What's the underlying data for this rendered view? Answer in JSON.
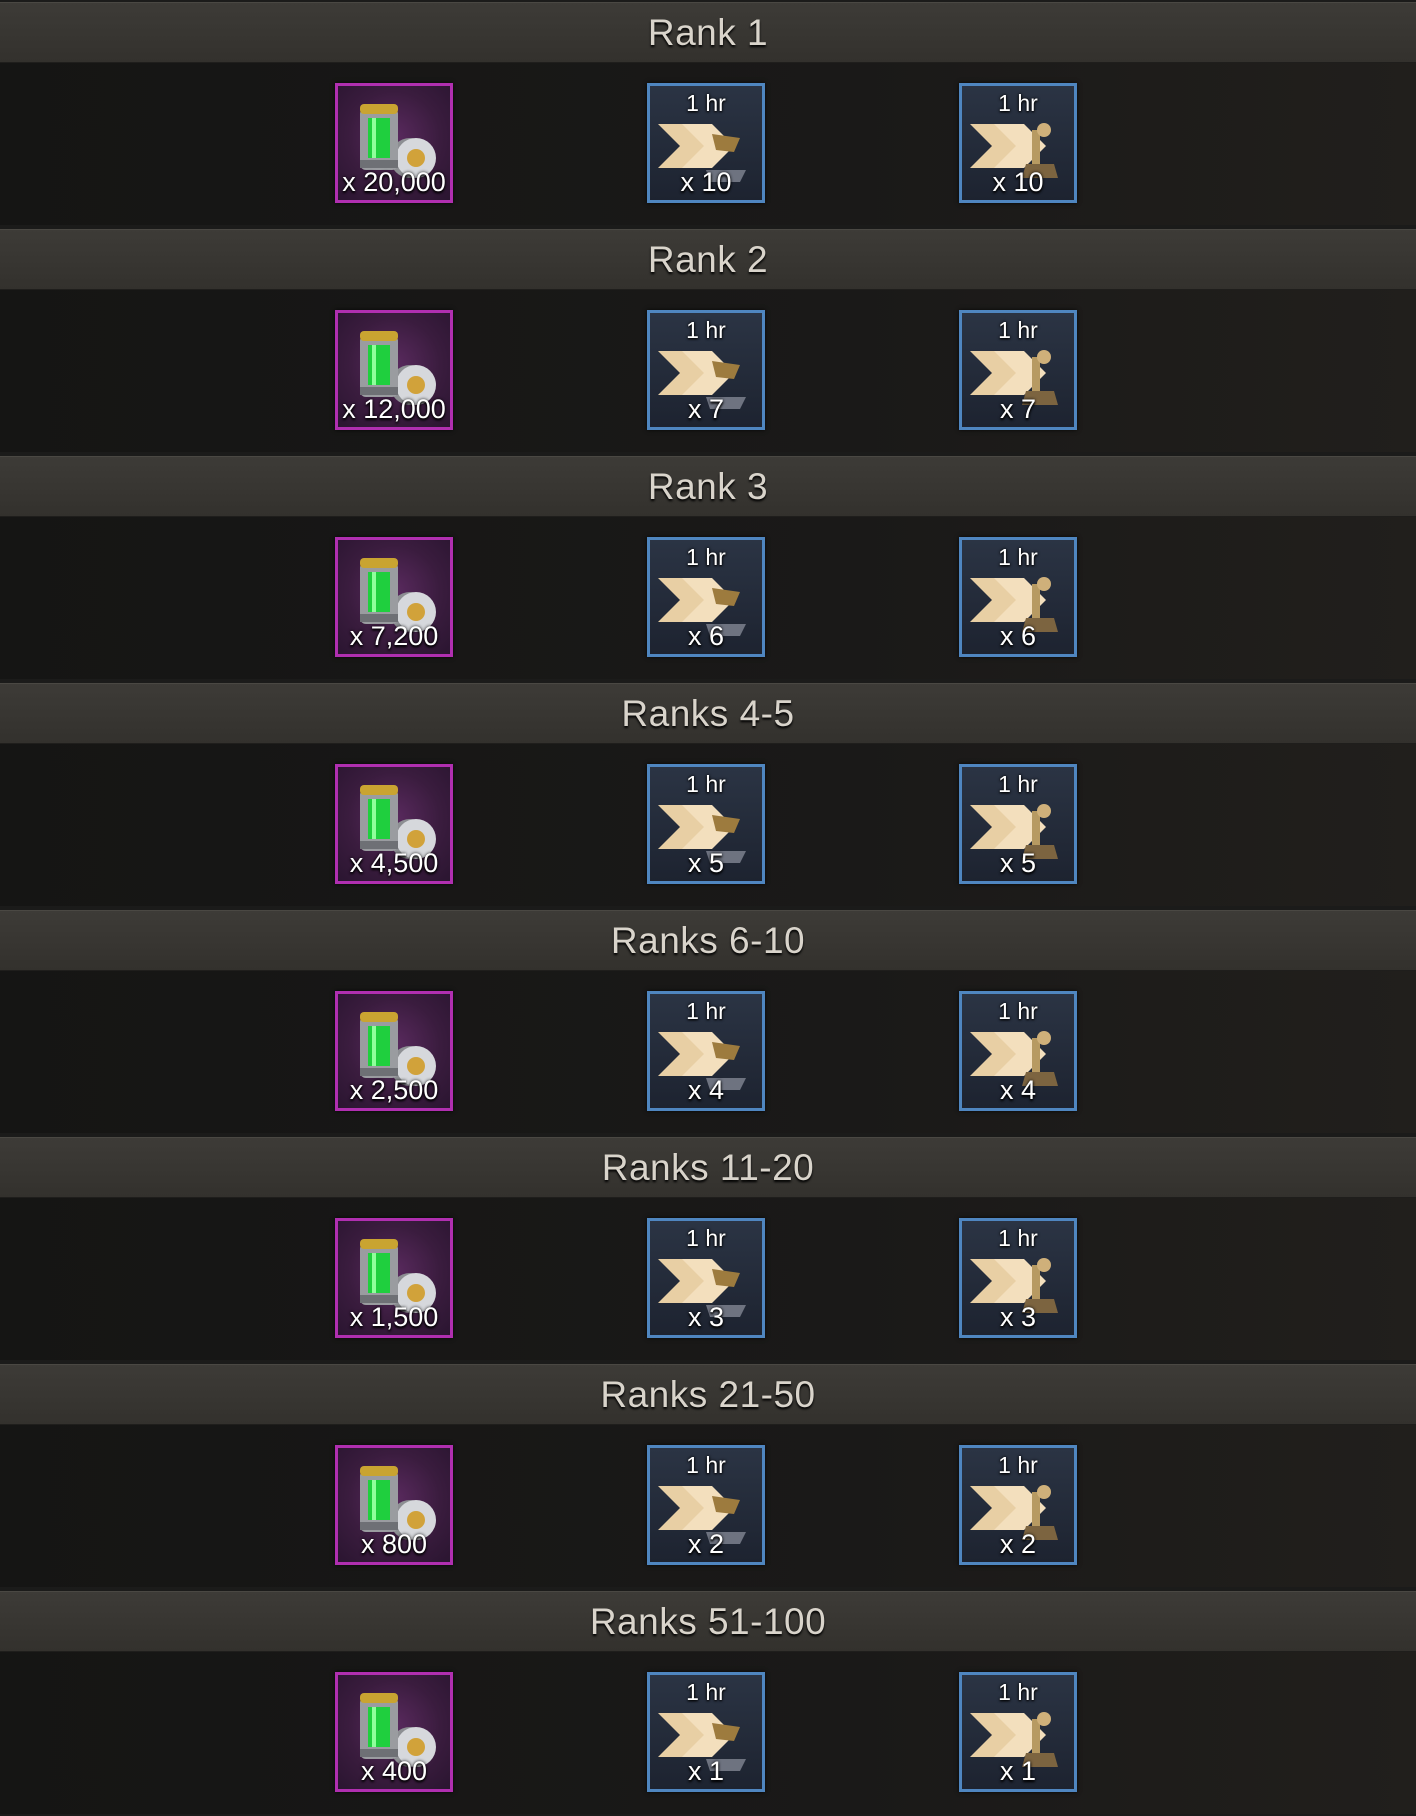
{
  "tiers": [
    {
      "rank": "Rank 1",
      "fuel_qty": "x 20,000",
      "speedup_a": {
        "duration": "1 hr",
        "qty": "x 10"
      },
      "speedup_b": {
        "duration": "1 hr",
        "qty": "x 10"
      }
    },
    {
      "rank": "Rank 2",
      "fuel_qty": "x 12,000",
      "speedup_a": {
        "duration": "1 hr",
        "qty": "x 7"
      },
      "speedup_b": {
        "duration": "1 hr",
        "qty": "x 7"
      }
    },
    {
      "rank": "Rank 3",
      "fuel_qty": "x 7,200",
      "speedup_a": {
        "duration": "1 hr",
        "qty": "x 6"
      },
      "speedup_b": {
        "duration": "1 hr",
        "qty": "x 6"
      }
    },
    {
      "rank": "Ranks 4-5",
      "fuel_qty": "x 4,500",
      "speedup_a": {
        "duration": "1 hr",
        "qty": "x 5"
      },
      "speedup_b": {
        "duration": "1 hr",
        "qty": "x 5"
      }
    },
    {
      "rank": "Ranks 6-10",
      "fuel_qty": "x 2,500",
      "speedup_a": {
        "duration": "1 hr",
        "qty": "x 4"
      },
      "speedup_b": {
        "duration": "1 hr",
        "qty": "x 4"
      }
    },
    {
      "rank": "Ranks 11-20",
      "fuel_qty": "x 1,500",
      "speedup_a": {
        "duration": "1 hr",
        "qty": "x 3"
      },
      "speedup_b": {
        "duration": "1 hr",
        "qty": "x 3"
      }
    },
    {
      "rank": "Ranks 21-50",
      "fuel_qty": "x 800",
      "speedup_a": {
        "duration": "1 hr",
        "qty": "x 2"
      },
      "speedup_b": {
        "duration": "1 hr",
        "qty": "x 2"
      }
    },
    {
      "rank": "Ranks 51-100",
      "fuel_qty": "x 400",
      "speedup_a": {
        "duration": "1 hr",
        "qty": "x 1"
      },
      "speedup_b": {
        "duration": "1 hr",
        "qty": "x 1"
      }
    }
  ],
  "icons": {
    "fuel": "fuel-canister-icon",
    "speedup_a": "training-speedup-icon",
    "speedup_b": "research-speedup-icon"
  },
  "colors": {
    "fuel_frame": "#b02fb0",
    "speedup_frame": "#4f86c0",
    "header_text": "#d9d4cb"
  }
}
